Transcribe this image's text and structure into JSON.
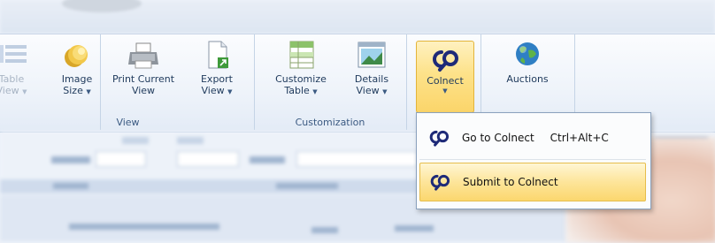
{
  "ribbon": {
    "view_group": {
      "label": "View",
      "buttons": [
        {
          "line1": "Table",
          "line2": "View"
        },
        {
          "line1": "Image",
          "line2": "Size"
        },
        {
          "line1": "Print Current",
          "line2": "View"
        },
        {
          "line1": "Export",
          "line2": "View"
        }
      ]
    },
    "customization_group": {
      "label": "Customization",
      "buttons": [
        {
          "line1": "Customize",
          "line2": "Table"
        },
        {
          "line1": "Details",
          "line2": "View"
        }
      ]
    },
    "colnect": {
      "label": "Colnect"
    },
    "auctions": {
      "label": "Auctions"
    }
  },
  "dropdown": {
    "items": [
      {
        "label": "Go to Colnect",
        "shortcut": "Ctrl+Alt+C"
      },
      {
        "label": "Submit to Colnect",
        "shortcut": ""
      }
    ]
  },
  "colors": {
    "accent_highlight": "#fde28a",
    "colnect_icon": "#1e2a78",
    "ribbon_bg": "#eef3fa"
  }
}
